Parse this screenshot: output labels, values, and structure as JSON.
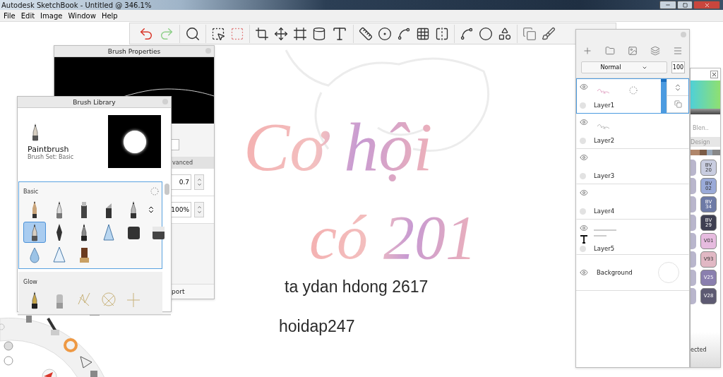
{
  "window": {
    "title": "Autodesk SketchBook - Untitled @ 346.1%"
  },
  "menu": [
    "File",
    "Edit",
    "Image",
    "Window",
    "Help"
  ],
  "canvas": {
    "lettering": [
      {
        "text": "Cơ hội"
      },
      {
        "text": "có 201"
      }
    ],
    "texts": [
      "ta ydan hdong 2617",
      "hoidap247"
    ]
  },
  "brush_properties": {
    "title": "Brush Properties",
    "tab": "vanced",
    "fields": [
      {
        "value": "0.7"
      },
      {
        "value": "100%"
      }
    ],
    "footer": "port"
  },
  "brush_library": {
    "title": "Brush Library",
    "brush_name": "Paintbrush",
    "brush_set": "Brush Set: Basic",
    "sections": [
      {
        "title": "Basic",
        "selected": true,
        "brushes": [
          {
            "kind": "pencil",
            "selected": false
          },
          {
            "kind": "technical",
            "selected": false
          },
          {
            "kind": "marker",
            "selected": false
          },
          {
            "kind": "chisel",
            "selected": false
          },
          {
            "kind": "ballpoint",
            "selected": false
          },
          {
            "kind": "paintbrush",
            "selected": true
          },
          {
            "kind": "nib",
            "selected": false
          },
          {
            "kind": "felt",
            "selected": false
          },
          {
            "kind": "airbrush",
            "selected": false
          },
          {
            "kind": "block",
            "selected": false
          },
          {
            "kind": "eraser",
            "selected": false
          },
          {
            "kind": "drop",
            "selected": false
          },
          {
            "kind": "cone",
            "selected": false
          },
          {
            "kind": "stamp",
            "selected": false
          }
        ]
      },
      {
        "title": "Glow",
        "selected": false,
        "brushes": [
          {
            "kind": "tapered",
            "selected": false
          },
          {
            "kind": "capped",
            "selected": false
          },
          {
            "kind": "sparkle",
            "selected": false
          },
          {
            "kind": "scribble",
            "selected": false
          },
          {
            "kind": "cross",
            "selected": false
          }
        ]
      }
    ]
  },
  "layers": {
    "blend_mode": "Normal",
    "opacity": "100",
    "items": [
      {
        "name": "Layer1",
        "kind": "paint",
        "selected": true
      },
      {
        "name": "Layer2",
        "kind": "paint",
        "selected": false
      },
      {
        "name": "Layer3",
        "kind": "paint",
        "selected": false
      },
      {
        "name": "Layer4",
        "kind": "paint",
        "selected": false
      },
      {
        "name": "Layer5",
        "kind": "text",
        "selected": false
      },
      {
        "name": "Background",
        "kind": "background",
        "selected": false
      }
    ]
  },
  "copic": {
    "label": "Blen..",
    "tab": "Design",
    "footer": "ected",
    "markers": [
      {
        "code": "BV 20",
        "color": "#c9cde0"
      },
      {
        "code": "BV 02",
        "color": "#9aaad8"
      },
      {
        "code": "BV 34",
        "color": "#6d7aa6"
      },
      {
        "code": "BV 29",
        "color": "#3e3f52"
      },
      {
        "code": "V01",
        "color": "#e6bbdf"
      },
      {
        "code": "V93",
        "color": "#e1b8c4"
      },
      {
        "code": "V25",
        "color": "#8a7fae"
      },
      {
        "code": "V28",
        "color": "#5d5a72"
      }
    ]
  }
}
